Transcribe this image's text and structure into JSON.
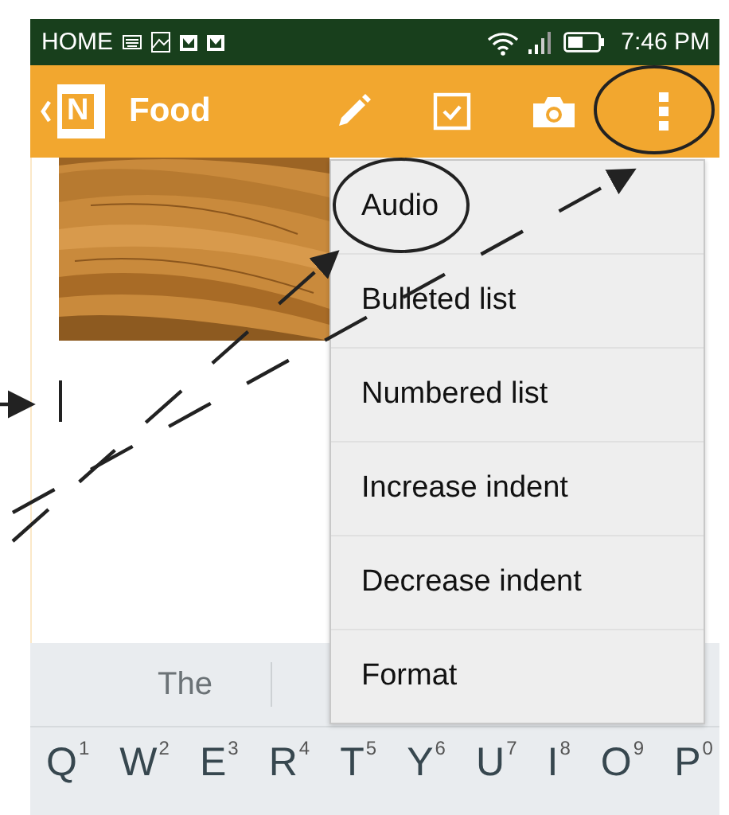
{
  "status_bar": {
    "carrier": "HOME",
    "time": "7:46 PM"
  },
  "app_bar": {
    "logo_letter": "N",
    "title": "Food"
  },
  "menu": {
    "items": [
      {
        "label": "Audio"
      },
      {
        "label": "Bulleted list"
      },
      {
        "label": "Numbered list"
      },
      {
        "label": "Increase indent"
      },
      {
        "label": "Decrease indent"
      },
      {
        "label": "Format"
      }
    ]
  },
  "keyboard": {
    "suggestions": [
      "The"
    ],
    "keys": [
      {
        "letter": "Q",
        "hint": "1"
      },
      {
        "letter": "W",
        "hint": "2"
      },
      {
        "letter": "E",
        "hint": "3"
      },
      {
        "letter": "R",
        "hint": "4"
      },
      {
        "letter": "T",
        "hint": "5"
      },
      {
        "letter": "Y",
        "hint": "6"
      },
      {
        "letter": "U",
        "hint": "7"
      },
      {
        "letter": "I",
        "hint": "8"
      },
      {
        "letter": "O",
        "hint": "9"
      },
      {
        "letter": "P",
        "hint": "0"
      }
    ]
  }
}
